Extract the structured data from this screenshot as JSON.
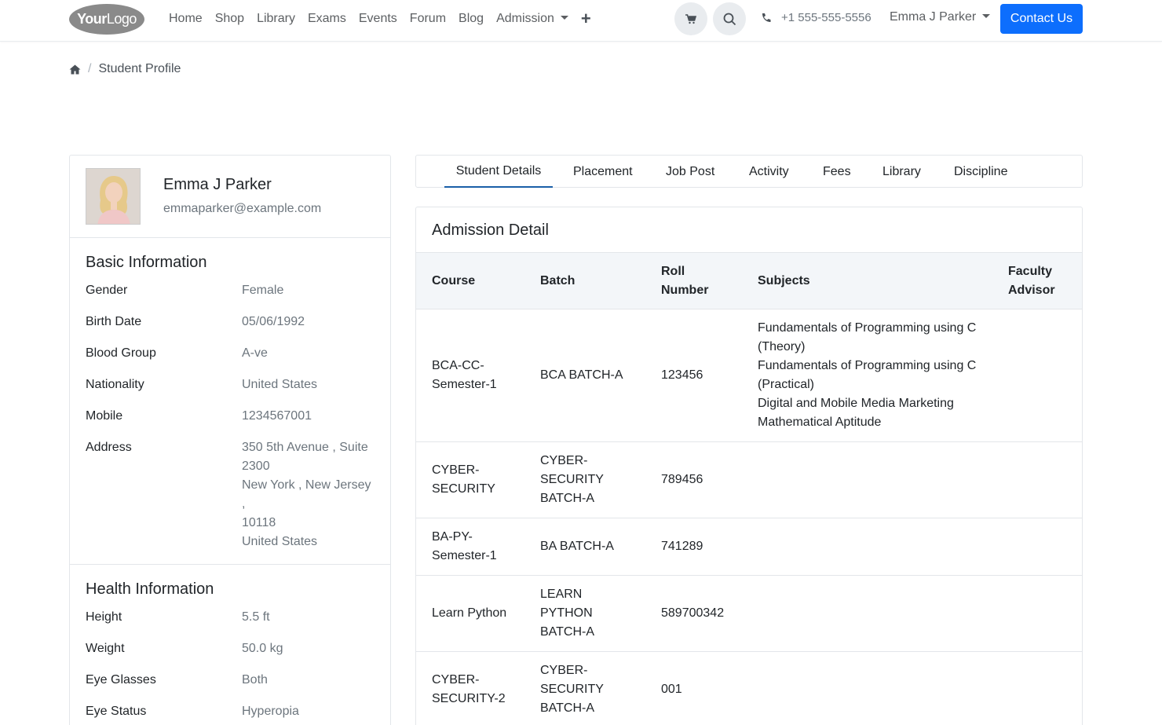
{
  "navbar": {
    "logo_text_bold": "Your",
    "logo_text": "Logo",
    "links": [
      "Home",
      "Shop",
      "Library",
      "Exams",
      "Events",
      "Forum",
      "Blog",
      "Admission"
    ],
    "phone": "+1 555-555-5556",
    "user_name": "Emma J Parker",
    "contact_label": "Contact Us",
    "accent_color": "#0d6efd"
  },
  "breadcrumb": {
    "home_icon": "home-icon",
    "current": "Student Profile"
  },
  "profile": {
    "name": "Emma J Parker",
    "email": "emmaparker@example.com"
  },
  "basic_info": {
    "title": "Basic Information",
    "rows": [
      {
        "label": "Gender",
        "value": "Female"
      },
      {
        "label": "Birth Date",
        "value": "05/06/1992"
      },
      {
        "label": "Blood Group",
        "value": "A-ve"
      },
      {
        "label": "Nationality",
        "value": "United States"
      },
      {
        "label": "Mobile",
        "value": "1234567001"
      },
      {
        "label": "Address",
        "value": "350 5th Avenue , Suite\n2300\nNew York , New Jersey ,\n10118\nUnited States"
      }
    ]
  },
  "health_info": {
    "title": "Health Information",
    "rows": [
      {
        "label": "Height",
        "value": "5.5 ft"
      },
      {
        "label": "Weight",
        "value": "50.0 kg"
      },
      {
        "label": "Eye Glasses",
        "value": "Both"
      },
      {
        "label": "Eye Status",
        "value": "Hyperopia"
      }
    ]
  },
  "tabs": [
    "Student Details",
    "Placement",
    "Job Post",
    "Activity",
    "Fees",
    "Library",
    "Discipline"
  ],
  "active_tab": "Student Details",
  "admission": {
    "title": "Admission Detail",
    "columns": [
      "Course",
      "Batch",
      "Roll\nNumber",
      "Subjects",
      "Faculty\nAdvisor"
    ],
    "rows": [
      {
        "course": "BCA-CC-\nSemester-1",
        "batch": "BCA BATCH-A",
        "roll": "123456",
        "subjects": "Fundamentals of Programming using C\n(Theory)\nFundamentals of Programming using C\n(Practical)\nDigital and Mobile Media Marketing\nMathematical Aptitude",
        "advisor": ""
      },
      {
        "course": "CYBER-\nSECURITY",
        "batch": "CYBER-\nSECURITY\nBATCH-A",
        "roll": "789456",
        "subjects": "",
        "advisor": ""
      },
      {
        "course": "BA-PY-\nSemester-1",
        "batch": "BA BATCH-A",
        "roll": "741289",
        "subjects": "",
        "advisor": ""
      },
      {
        "course": "Learn Python",
        "batch": "LEARN\nPYTHON\nBATCH-A",
        "roll": "589700342",
        "subjects": "",
        "advisor": ""
      },
      {
        "course": "CYBER-\nSECURITY-2",
        "batch": "CYBER-\nSECURITY\nBATCH-A",
        "roll": "001",
        "subjects": "",
        "advisor": ""
      }
    ]
  }
}
